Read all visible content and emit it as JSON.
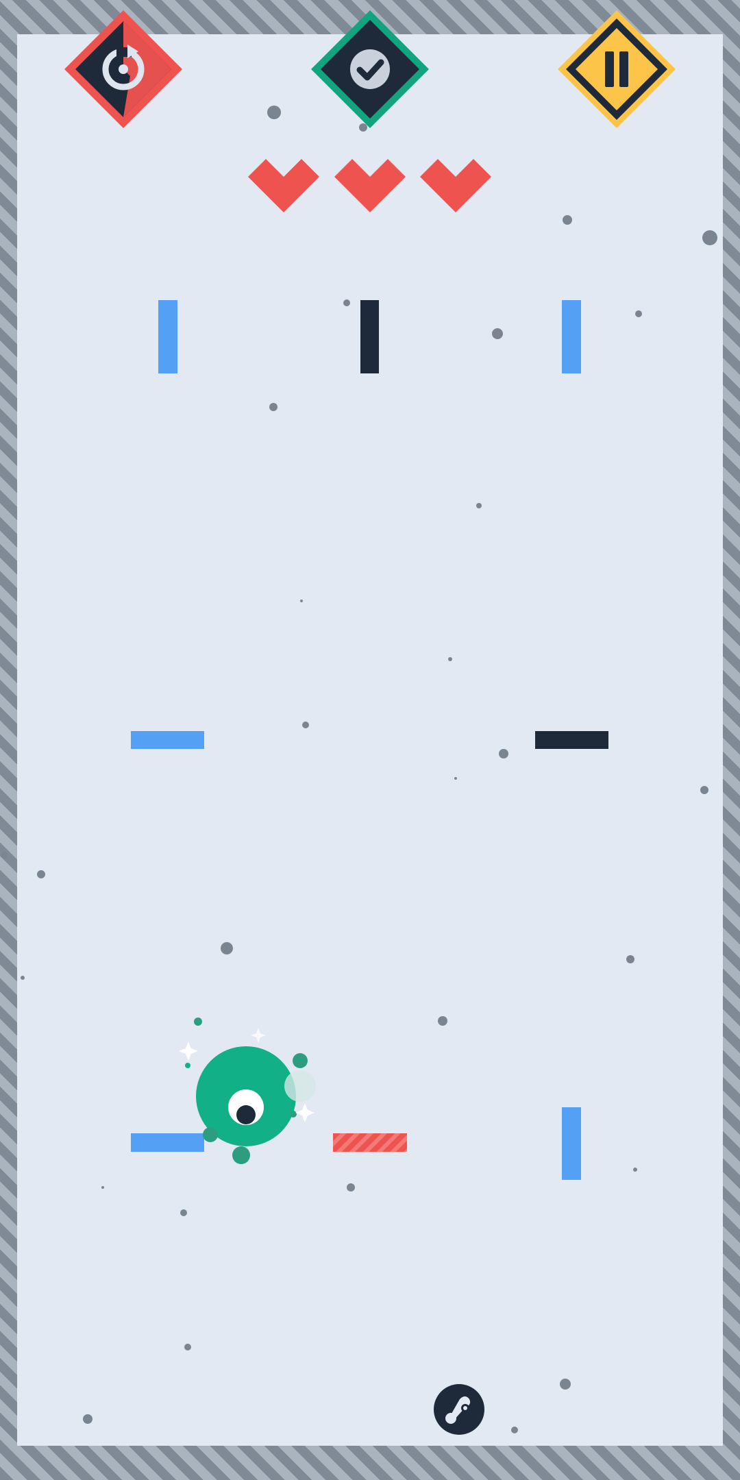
{
  "hud": {
    "restart_button": {
      "icon": "restart-icon",
      "color": "#ef5350",
      "frame": "#1e2a3a"
    },
    "confirm_button": {
      "icon": "check-icon",
      "color": "#12a37f",
      "frame": "#1e2a3a"
    },
    "pause_button": {
      "icon": "pause-icon",
      "color": "#fcc54a",
      "frame": "#1e2a3a"
    },
    "lives": {
      "current": 3,
      "max": 3,
      "icon": "heart-icon",
      "color": "#ef5350"
    }
  },
  "pads": {
    "colors": {
      "blue": "#54a0f5",
      "dark": "#1e2a3a",
      "danger": "#ef5350"
    },
    "kinds": [
      "blue-vertical",
      "dark-vertical",
      "blue-vertical",
      "blue-horizontal",
      "dark-horizontal",
      "blue-horizontal",
      "red-striped-hazard",
      "blue-vertical"
    ]
  },
  "player": {
    "icon": "green-blob-icon",
    "color": "#12b086"
  },
  "ability_button": {
    "icon": "ability-icon"
  }
}
